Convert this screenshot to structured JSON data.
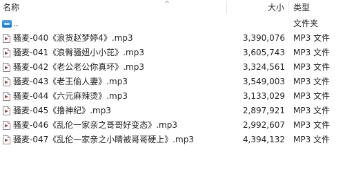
{
  "columns": {
    "name": "名称",
    "size": "大小",
    "type": "类型"
  },
  "sort_indicator": "^",
  "parent_row": {
    "name": "..",
    "type": "文件夹"
  },
  "files": [
    {
      "name": "骚麦-040《浪货赵梦婷4》.mp3",
      "size": "3,390,076",
      "type": "MP3 文件"
    },
    {
      "name": "骚麦-041《浪臀骚妞小小芘》.mp3",
      "size": "3,605,743",
      "type": "MP3 文件"
    },
    {
      "name": "骚麦-042《老公老公你真坏》.mp3",
      "size": "3,324,561",
      "type": "MP3 文件"
    },
    {
      "name": "骚麦-043《老王偷人妻》.mp3",
      "size": "3,549,003",
      "type": "MP3 文件"
    },
    {
      "name": "骚麦-044《六元麻辣烫》.mp3",
      "size": "3,133,029",
      "type": "MP3 文件"
    },
    {
      "name": "骚麦-045《撸神纪》.mp3",
      "size": "2,897,921",
      "type": "MP3 文件"
    },
    {
      "name": "骚麦-046《乱伦一家亲之哥哥好变态》.mp3",
      "size": "2,992,607",
      "type": "MP3 文件"
    },
    {
      "name": "骚麦-047《乱伦一家亲之小睛被哥哥硬上》.mp3",
      "size": "4,394,132",
      "type": "MP3 文件"
    }
  ],
  "icon_names": {
    "file": "mp3-file-icon",
    "parent": "parent-folder-icon"
  },
  "colors": {
    "accent": "#c0392b"
  }
}
